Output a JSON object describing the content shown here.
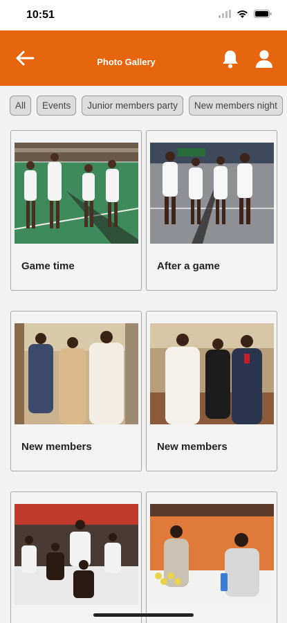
{
  "status_bar": {
    "time": "10:51"
  },
  "app_bar": {
    "title": "Photo Gallery"
  },
  "filters": [
    "All",
    "Events",
    "Junior members party",
    "New members night"
  ],
  "gallery": [
    {
      "title": "Game time"
    },
    {
      "title": "After a game"
    },
    {
      "title": "New members"
    },
    {
      "title": "New members"
    },
    {
      "title": ""
    },
    {
      "title": ""
    }
  ],
  "colors": {
    "accent": "#e8650f",
    "background": "#f2f2f2"
  }
}
